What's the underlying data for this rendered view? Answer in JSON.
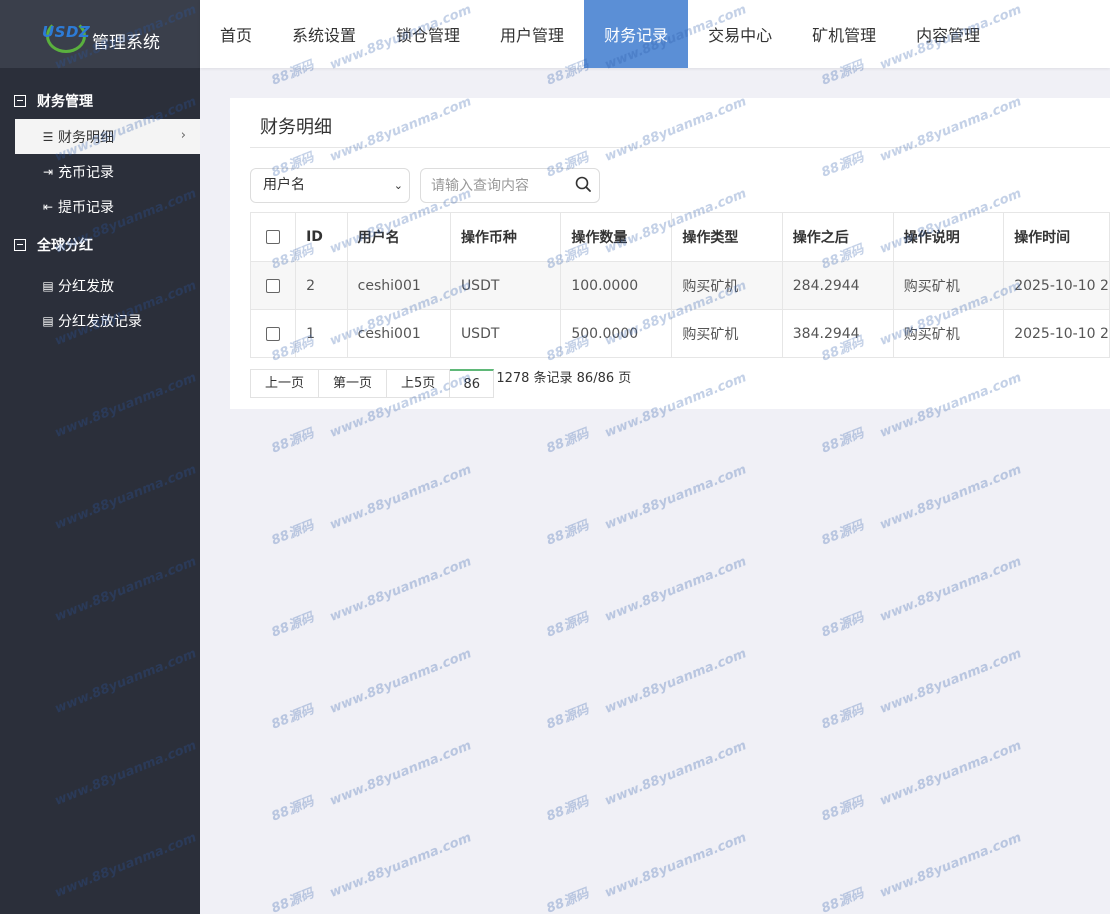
{
  "logo": {
    "mark": "USDZ",
    "title": "管理系统"
  },
  "topnav": [
    "首页",
    "系统设置",
    "锁仓管理",
    "用户管理",
    "财务记录",
    "交易中心",
    "矿机管理",
    "内容管理"
  ],
  "topnav_active_index": 4,
  "sidebar": {
    "groups": [
      {
        "label": "财务管理",
        "items": [
          "财务明细",
          "充币记录",
          "提币记录"
        ]
      },
      {
        "label": "全球分红",
        "items": [
          "分红发放",
          "分红发放记录"
        ]
      }
    ],
    "active_item": "财务明细"
  },
  "page": {
    "title": "财务明细"
  },
  "filter": {
    "select_value": "用户名",
    "search_placeholder": "请输入查询内容"
  },
  "table": {
    "headers": [
      "ID",
      "用户名",
      "操作币种",
      "操作数量",
      "操作类型",
      "操作之后",
      "操作说明",
      "操作时间"
    ],
    "rows": [
      [
        "2",
        "ceshi001",
        "USDT",
        "100.0000",
        "购买矿机",
        "284.2944",
        "购买矿机",
        "2025-10-10 2"
      ],
      [
        "1",
        "ceshi001",
        "USDT",
        "500.0000",
        "购买矿机",
        "384.2944",
        "购买矿机",
        "2025-10-10 2"
      ]
    ]
  },
  "pager": {
    "prev": "上一页",
    "first": "第一页",
    "prev5": "上5页",
    "current": "86",
    "info": "1278 条记录 86/86 页"
  },
  "watermark": {
    "text1": "www.88yuanma.com",
    "text2": "88源码"
  },
  "colors": {
    "sidebar": "#2b2f3a",
    "nav_active": "#5b8fd6",
    "pager_accent": "#5fb878"
  }
}
